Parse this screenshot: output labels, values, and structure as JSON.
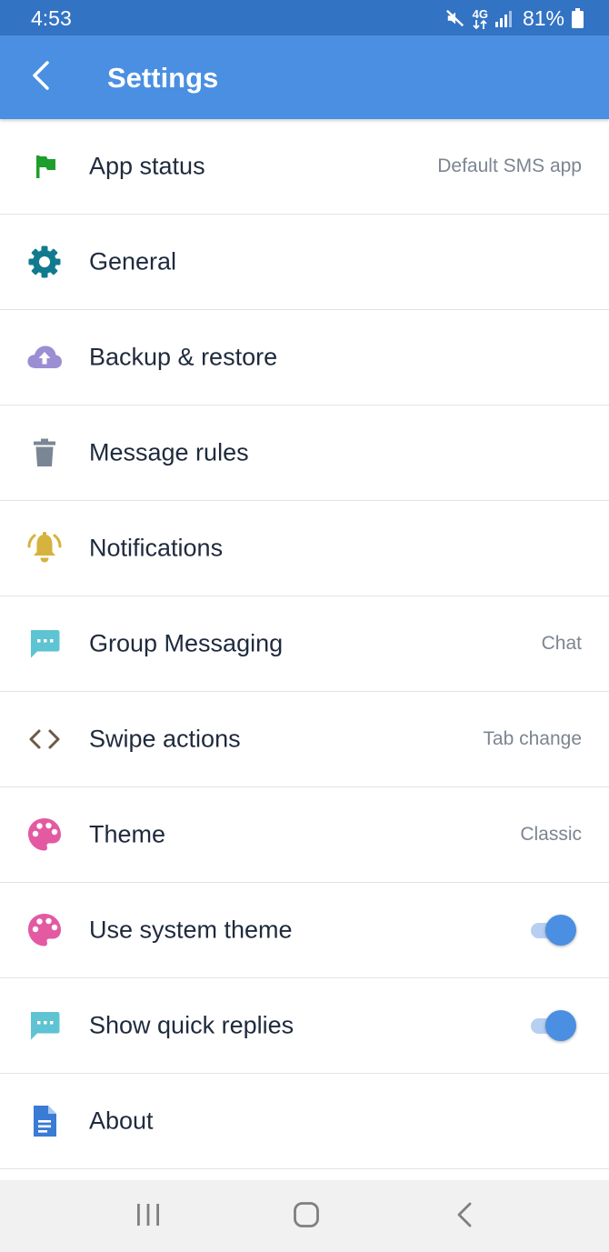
{
  "status_bar": {
    "time": "4:53",
    "network": "4G",
    "battery": "81%",
    "icons": [
      "mute-icon",
      "network-4g-icon",
      "signal-icon",
      "battery-icon"
    ]
  },
  "app_bar": {
    "title": "Settings",
    "back_icon": "back-arrow-icon"
  },
  "settings": [
    {
      "label": "App status",
      "value": "Default SMS app",
      "icon": "flag-icon",
      "icon_color": "#1e9e2c"
    },
    {
      "label": "General",
      "value": "",
      "icon": "gear-icon",
      "icon_color": "#127a8e"
    },
    {
      "label": "Backup & restore",
      "value": "",
      "icon": "cloud-upload-icon",
      "icon_color": "#9b8ed3"
    },
    {
      "label": "Message rules",
      "value": "",
      "icon": "trash-icon",
      "icon_color": "#7b8694"
    },
    {
      "label": "Notifications",
      "value": "",
      "icon": "bell-ringing-icon",
      "icon_color": "#d6b23e"
    },
    {
      "label": "Group Messaging",
      "value": "Chat",
      "icon": "chat-bubble-icon",
      "icon_color": "#5ec3d2"
    },
    {
      "label": "Swipe actions",
      "value": "Tab change",
      "icon": "code-arrows-icon",
      "icon_color": "#6b5a45"
    },
    {
      "label": "Theme",
      "value": "Classic",
      "icon": "palette-icon",
      "icon_color": "#e35aa3"
    },
    {
      "label": "Use system theme",
      "toggle": true,
      "icon": "palette-icon",
      "icon_color": "#e35aa3"
    },
    {
      "label": "Show quick replies",
      "toggle": true,
      "icon": "chat-bubble-icon",
      "icon_color": "#5ec3d2"
    },
    {
      "label": "About",
      "value": "",
      "icon": "document-icon",
      "icon_color": "#3a7bd5"
    }
  ],
  "nav_bar": {
    "icons": [
      "recent-apps-icon",
      "home-icon",
      "back-icon"
    ]
  },
  "colors": {
    "status_bar": "#3373c4",
    "app_bar": "#4a8fe2",
    "accent": "#4a8fe2",
    "text": "#1f2a3d",
    "secondary_text": "#7c8591"
  }
}
